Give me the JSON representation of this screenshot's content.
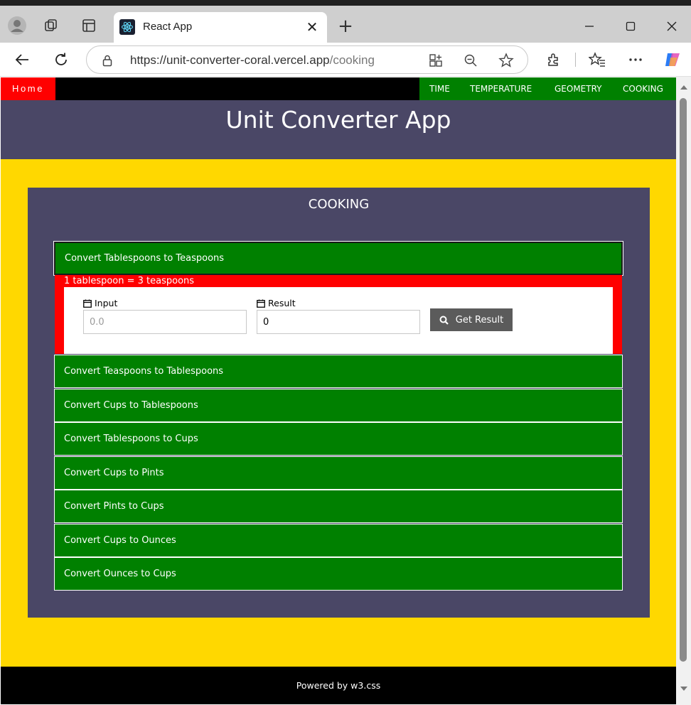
{
  "browser": {
    "tab_title": "React App",
    "url_host": "https://unit-converter-coral.vercel.app",
    "url_path": "/cooking",
    "icons": [
      "profile-icon",
      "collections-icon",
      "tab-actions-icon",
      "react-favicon-icon",
      "close-icon",
      "new-tab-icon",
      "minimize-icon",
      "maximize-icon",
      "window-close-icon",
      "back-icon",
      "refresh-icon",
      "lock-icon",
      "app-available-icon",
      "zoom-icon",
      "favorite-star-icon",
      "extensions-icon",
      "favorites-icon",
      "more-icon",
      "copilot-icon"
    ]
  },
  "nav": {
    "home": "Home",
    "links": [
      "TIME",
      "TEMPERATURE",
      "GEOMETRY",
      "COOKING"
    ]
  },
  "header": {
    "title": "Unit Converter App"
  },
  "section": {
    "title": "COOKING"
  },
  "accordion": {
    "open_item": "Convert Tablespoons to Teaspoons",
    "note": "1 tablespoon = 3 teaspoons",
    "input_label": "Input",
    "input_placeholder": "0.0",
    "result_label": "Result",
    "result_value": "0",
    "button_label": "Get Result",
    "items": [
      "Convert Teaspoons to Tablespoons",
      "Convert Cups to Tablespoons",
      "Convert Tablespoons to Cups",
      "Convert Cups to Pints",
      "Convert Pints to Cups",
      "Convert Cups to Ounces",
      "Convert Ounces to Cups"
    ]
  },
  "footer": {
    "text": "Powered by w3.css"
  },
  "colors": {
    "nav_home": "#ff0000",
    "nav_right": "#008000",
    "header_bg": "#4a4766",
    "page_bg": "#ffd800",
    "accordion_bg": "#008000",
    "panel_bg": "#ff0000",
    "button_bg": "#5b5b5b"
  }
}
